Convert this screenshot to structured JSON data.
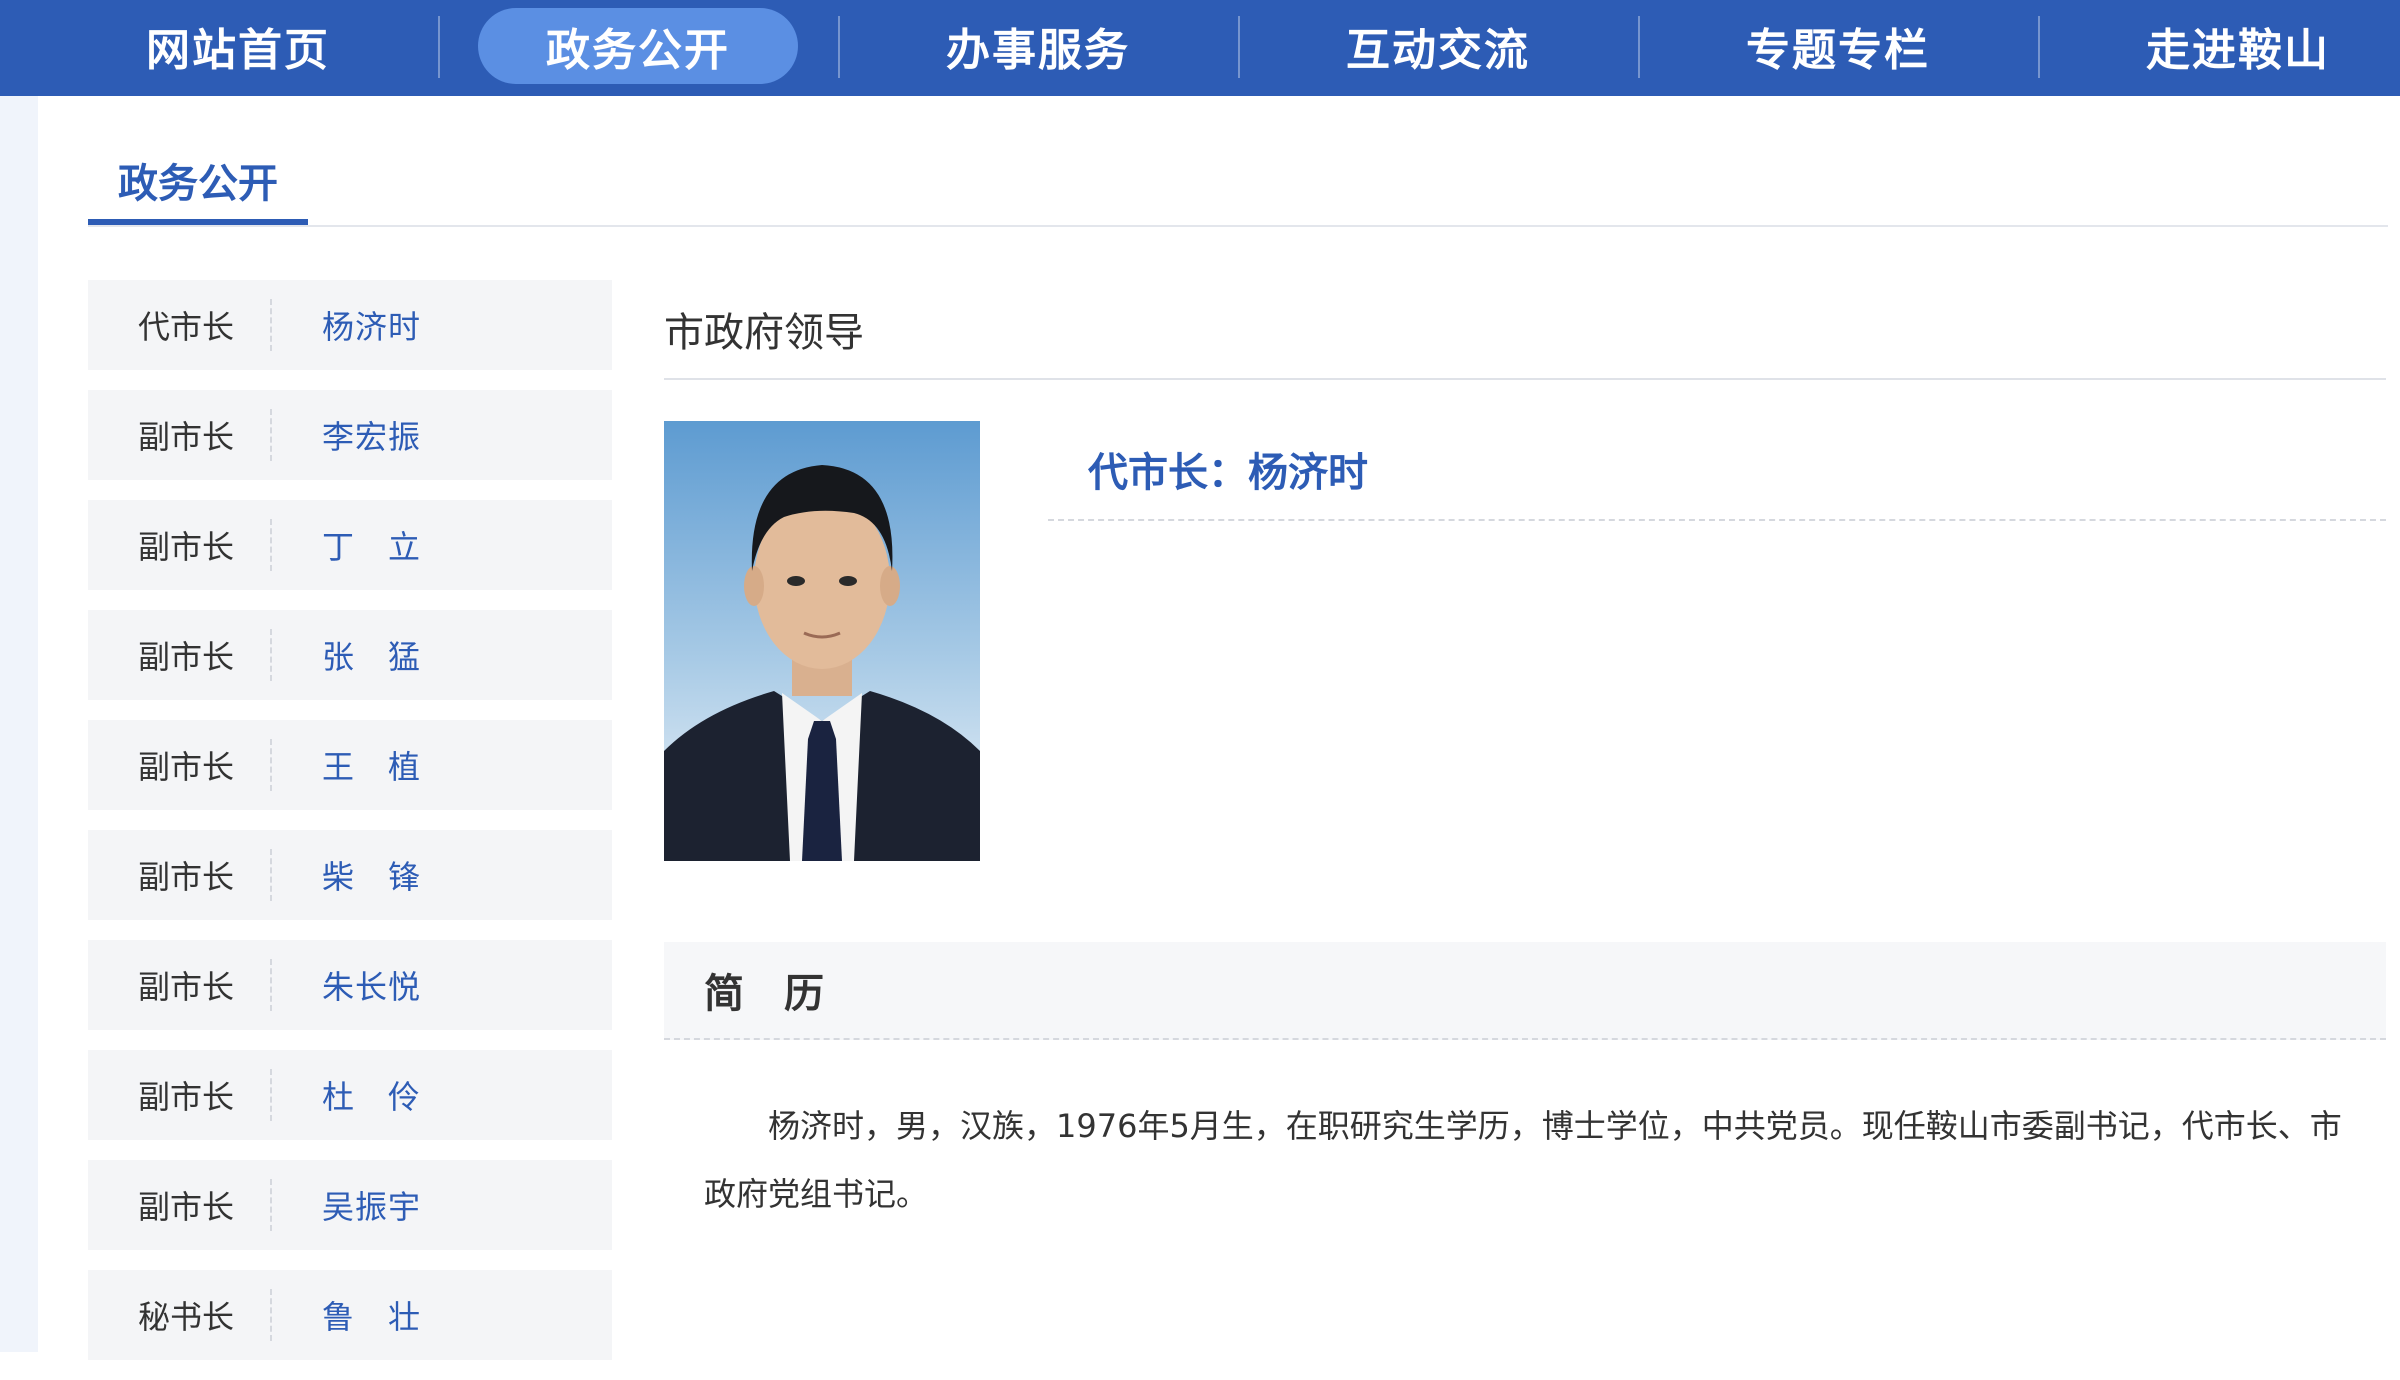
{
  "nav": {
    "items": [
      "网站首页",
      "政务公开",
      "办事服务",
      "互动交流",
      "专题专栏",
      "走进鞍山"
    ],
    "active_index": 1,
    "colors": {
      "bar": "#2d5cb5",
      "active_pill": "#5b8fe3"
    }
  },
  "section": {
    "title": "政务公开"
  },
  "sidebar": {
    "items": [
      {
        "role": "代市长",
        "name": "杨济时"
      },
      {
        "role": "副市长",
        "name": "李宏振"
      },
      {
        "role": "副市长",
        "name": "丁　立"
      },
      {
        "role": "副市长",
        "name": "张　猛"
      },
      {
        "role": "副市长",
        "name": "王　植"
      },
      {
        "role": "副市长",
        "name": "柴　锋"
      },
      {
        "role": "副市长",
        "name": "朱长悦"
      },
      {
        "role": "副市长",
        "name": "杜　伶"
      },
      {
        "role": "副市长",
        "name": "吴振宇"
      },
      {
        "role": "秘书长",
        "name": "鲁　壮"
      }
    ]
  },
  "main": {
    "heading": "市政府领导",
    "leader_title": "代市长：杨济时",
    "bio_header": "简　历",
    "bio_text": "杨济时，男，汉族，1976年5月生，在职研究生学历，博士学位，中共党员。现任鞍山市委副书记，代市长、市政府党组书记。"
  }
}
